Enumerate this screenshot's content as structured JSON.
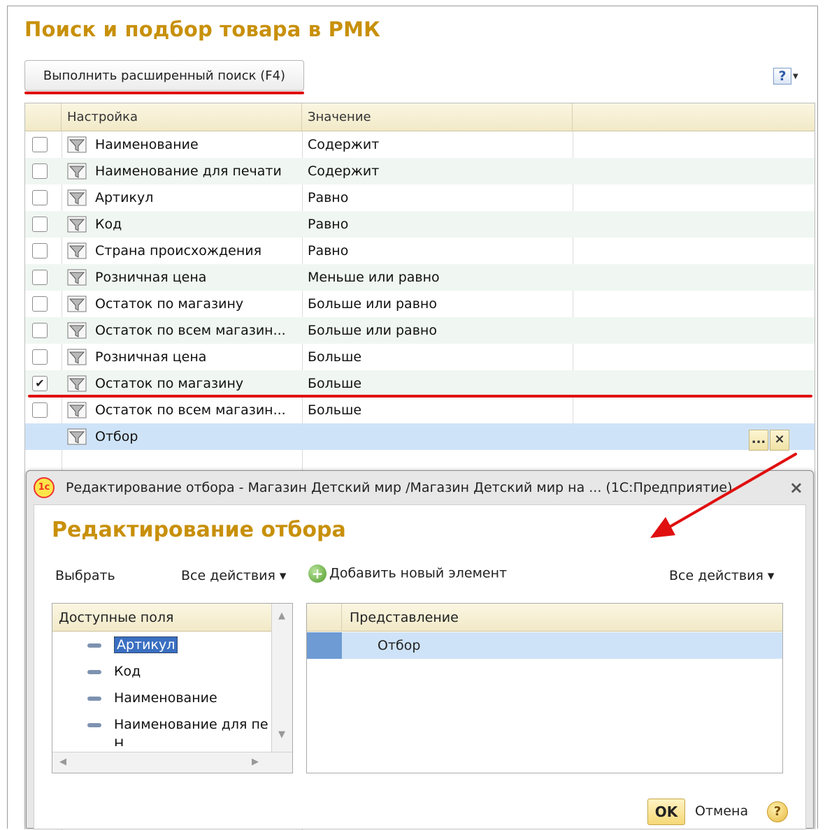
{
  "page": {
    "title": "Поиск и подбор товара в РМК",
    "search_button": "Выполнить расширенный поиск (F4)",
    "help_icon": "help-icon"
  },
  "grid": {
    "columns": [
      "Настройка",
      "Значение"
    ],
    "rows": [
      {
        "checked": false,
        "name": "Наименование",
        "value": "Содержит"
      },
      {
        "checked": false,
        "name": "Наименование для печати",
        "value": "Содержит"
      },
      {
        "checked": false,
        "name": "Артикул",
        "value": "Равно"
      },
      {
        "checked": false,
        "name": "Код",
        "value": "Равно"
      },
      {
        "checked": false,
        "name": "Страна происхождения",
        "value": "Равно"
      },
      {
        "checked": false,
        "name": "Розничная цена",
        "value": "Меньше или равно"
      },
      {
        "checked": false,
        "name": "Остаток по магазину",
        "value": "Больше или равно"
      },
      {
        "checked": false,
        "name": "Остаток по всем магазин...",
        "value": "Больше или равно"
      },
      {
        "checked": false,
        "name": "Розничная цена",
        "value": "Больше"
      },
      {
        "checked": true,
        "name": "Остаток по магазину",
        "value": "Больше"
      },
      {
        "checked": false,
        "name": "Остаток по всем магазин...",
        "value": "Больше"
      }
    ],
    "selected_row": {
      "name": "Отбор",
      "value": ""
    },
    "choose_button": "...",
    "clear_button": "×",
    "checkmark": "✔"
  },
  "dialog": {
    "window_title": "Редактирование отбора - Магазин Детский мир /Магазин Детский мир на ...  (1С:Предприятие)",
    "logo_text": "1с",
    "close": "×",
    "heading": "Редактирование отбора",
    "toolbar": {
      "choose": "Выбрать",
      "all_actions_left": "Все действия ▾",
      "add_element": "Добавить новый элемент",
      "all_actions_right": "Все действия ▾"
    },
    "available_fields": {
      "header": "Доступные поля",
      "items": [
        "Артикул",
        "Код",
        "Наименование",
        "Наименование для пе",
        "Н"
      ]
    },
    "representation": {
      "header": "Представление",
      "rows": [
        "Отбор"
      ]
    },
    "ok": "OK",
    "cancel": "Отмена",
    "help": "?"
  },
  "colors": {
    "accent_title": "#c8900a",
    "annotation_red": "#e01010",
    "selection_blue": "#cfe3f8"
  }
}
